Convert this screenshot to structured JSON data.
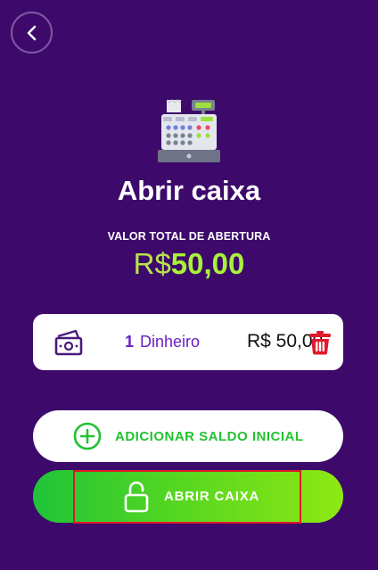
{
  "header": {
    "back_icon": "chevron-left-icon"
  },
  "hero": {
    "icon": "cash-register-icon",
    "title": "Abrir caixa",
    "subtitle": "VALOR TOTAL DE ABERTURA",
    "amount_currency": "R$",
    "amount_value": "50,00"
  },
  "payments": [
    {
      "count": "1",
      "method": "Dinheiro",
      "amount": "R$ 50,00",
      "icon": "cash-icon",
      "action_icon": "trash-icon"
    }
  ],
  "actions": {
    "add_label": "ADICIONAR SALDO INICIAL",
    "add_icon": "plus-circle-icon",
    "open_label": "ABRIR CAIXA",
    "open_icon": "unlock-icon"
  },
  "colors": {
    "background": "#3d0a6b",
    "accent_green": "#22c232",
    "amount_green": "#a8f23a",
    "purple_text": "#6a1fc4",
    "delete_red": "#e0192b"
  }
}
